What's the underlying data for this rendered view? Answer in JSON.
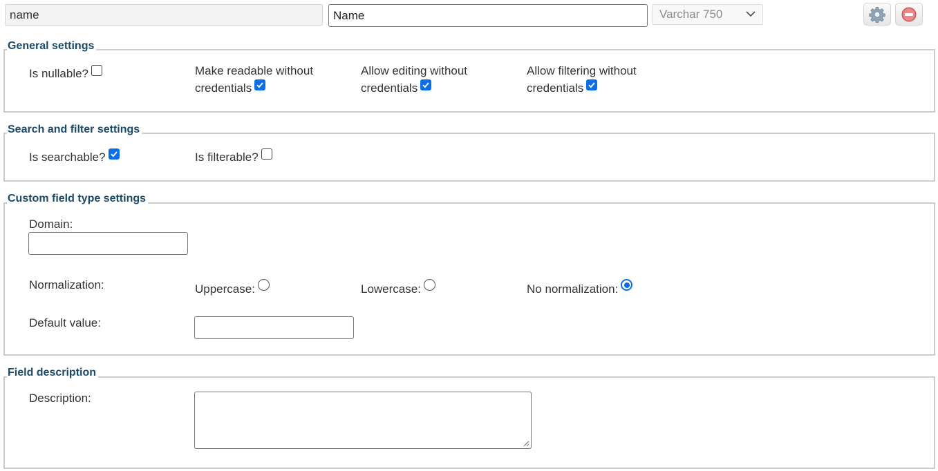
{
  "top": {
    "field_key": "name",
    "field_label": "Name",
    "field_type": "Varchar 750",
    "settings_icon": "gear-icon",
    "delete_icon": "no-entry-icon"
  },
  "general": {
    "legend": "General settings",
    "nullable_label": "Is nullable?",
    "nullable_checked": false,
    "readable_line1": "Make readable without",
    "readable_line2": "credentials",
    "readable_checked": true,
    "editing_line1": "Allow editing without",
    "editing_line2": "credentials",
    "editing_checked": true,
    "filtering_line1": "Allow filtering without",
    "filtering_line2": "credentials",
    "filtering_checked": true
  },
  "search": {
    "legend": "Search and filter settings",
    "searchable_label": "Is searchable?",
    "searchable_checked": true,
    "filterable_label": "Is filterable?",
    "filterable_checked": false
  },
  "custom": {
    "legend": "Custom field type settings",
    "domain_label": "Domain:",
    "domain_value": "",
    "normalization_label": "Normalization:",
    "uppercase_label": "Uppercase:",
    "lowercase_label": "Lowercase:",
    "none_label": "No normalization:",
    "selected_normalization": "No normalization",
    "default_label": "Default value:",
    "default_value": ""
  },
  "description": {
    "legend": "Field description",
    "label": "Description:",
    "value": ""
  },
  "colors": {
    "accent": "#0b6ee8",
    "legend_text": "#1b4a6b",
    "delete_red": "#d9534f"
  }
}
